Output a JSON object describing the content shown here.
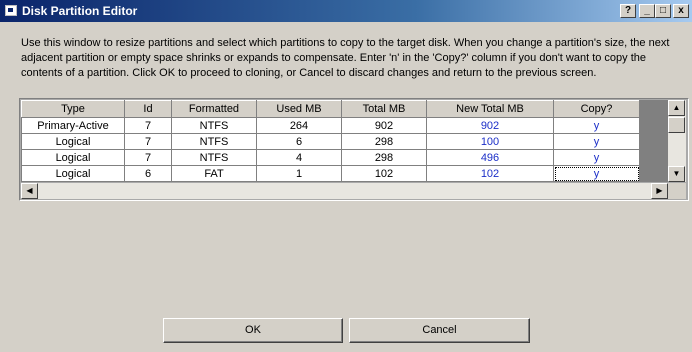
{
  "window": {
    "title": "Disk Partition Editor",
    "controls": {
      "help": "?",
      "minimize": "_",
      "maximize": "□",
      "close": "x"
    }
  },
  "instructions": "Use this window to resize partitions and select which partitions to copy to the target disk. When you change a partition's size, the next\nadjacent partition or empty space shrinks or expands to compensate. Enter 'n' in the 'Copy?' column if you don't want to copy the\ncontents of a partition. Click OK to proceed to cloning, or Cancel to discard changes and return to the previous screen.",
  "table": {
    "columns": [
      "Type",
      "Id",
      "Formatted",
      "Used MB",
      "Total MB",
      "New Total MB",
      "Copy?"
    ],
    "rows": [
      [
        "Primary-Active",
        "7",
        "NTFS",
        "264",
        "902",
        "902",
        "y"
      ],
      [
        "Logical",
        "7",
        "NTFS",
        "6",
        "298",
        "100",
        "y"
      ],
      [
        "Logical",
        "7",
        "NTFS",
        "4",
        "298",
        "496",
        "y"
      ],
      [
        "Logical",
        "6",
        "FAT",
        "1",
        "102",
        "102",
        "y"
      ]
    ]
  },
  "scroll": {
    "up": "▲",
    "down": "▼",
    "left": "◀",
    "right": "▶"
  },
  "buttons": {
    "ok": "OK",
    "cancel": "Cancel"
  },
  "colors": {
    "title_bar": "#0a246a",
    "edited_value": "#1c2fc8",
    "face": "#d4d0c8"
  }
}
